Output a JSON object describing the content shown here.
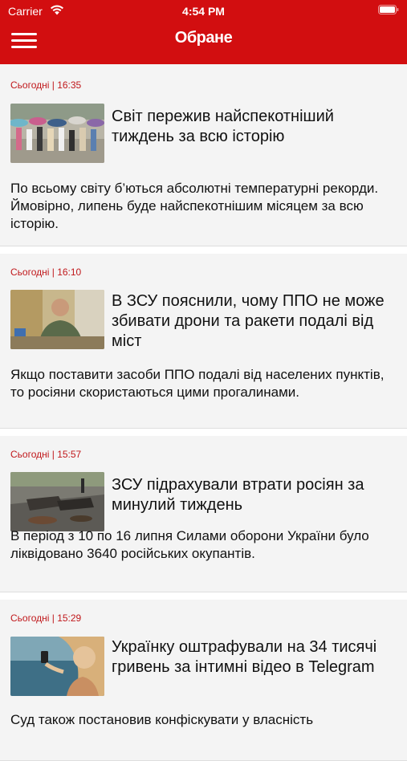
{
  "status_bar": {
    "carrier": "Carrier",
    "time": "4:54 PM"
  },
  "header": {
    "title": "Обране",
    "menu_icon": "hamburger-menu-icon",
    "background_color": "#d20e10"
  },
  "articles": [
    {
      "date": "Сьогодні | 16:35",
      "title": "Світ пережив найспекотніший тиждень за всю історію",
      "summary": "По всьому світу б’ються абсолютні температурні рекорди. Ймовірно, липень буде найспекотнішим місяцем за всю історію."
    },
    {
      "date": "Сьогодні | 16:10",
      "title": "В ЗСУ пояснили, чому ППО не може збивати дрони та ракети подалі від міст",
      "summary": "Якщо поставити засоби ППО подалі від населених пунктів, то росіяни скористаються цими прогалинами."
    },
    {
      "date": "Сьогодні | 15:57",
      "title": "ЗСУ підрахували втрати росіян за минулий тиждень",
      "summary": "В період з 10 по 16 липня Силами оборони України було ліквідовано 3640 російських окупантів."
    },
    {
      "date": "Сьогодні | 15:29",
      "title": "Українку оштрафували на 34 тисячі гривень за інтимні відео в Telegram",
      "summary": "Суд також постановив конфіскувати у власність"
    }
  ],
  "colors": {
    "accent": "#d20e10",
    "date_text": "#c0181b",
    "card_background": "#f4f4f4"
  }
}
